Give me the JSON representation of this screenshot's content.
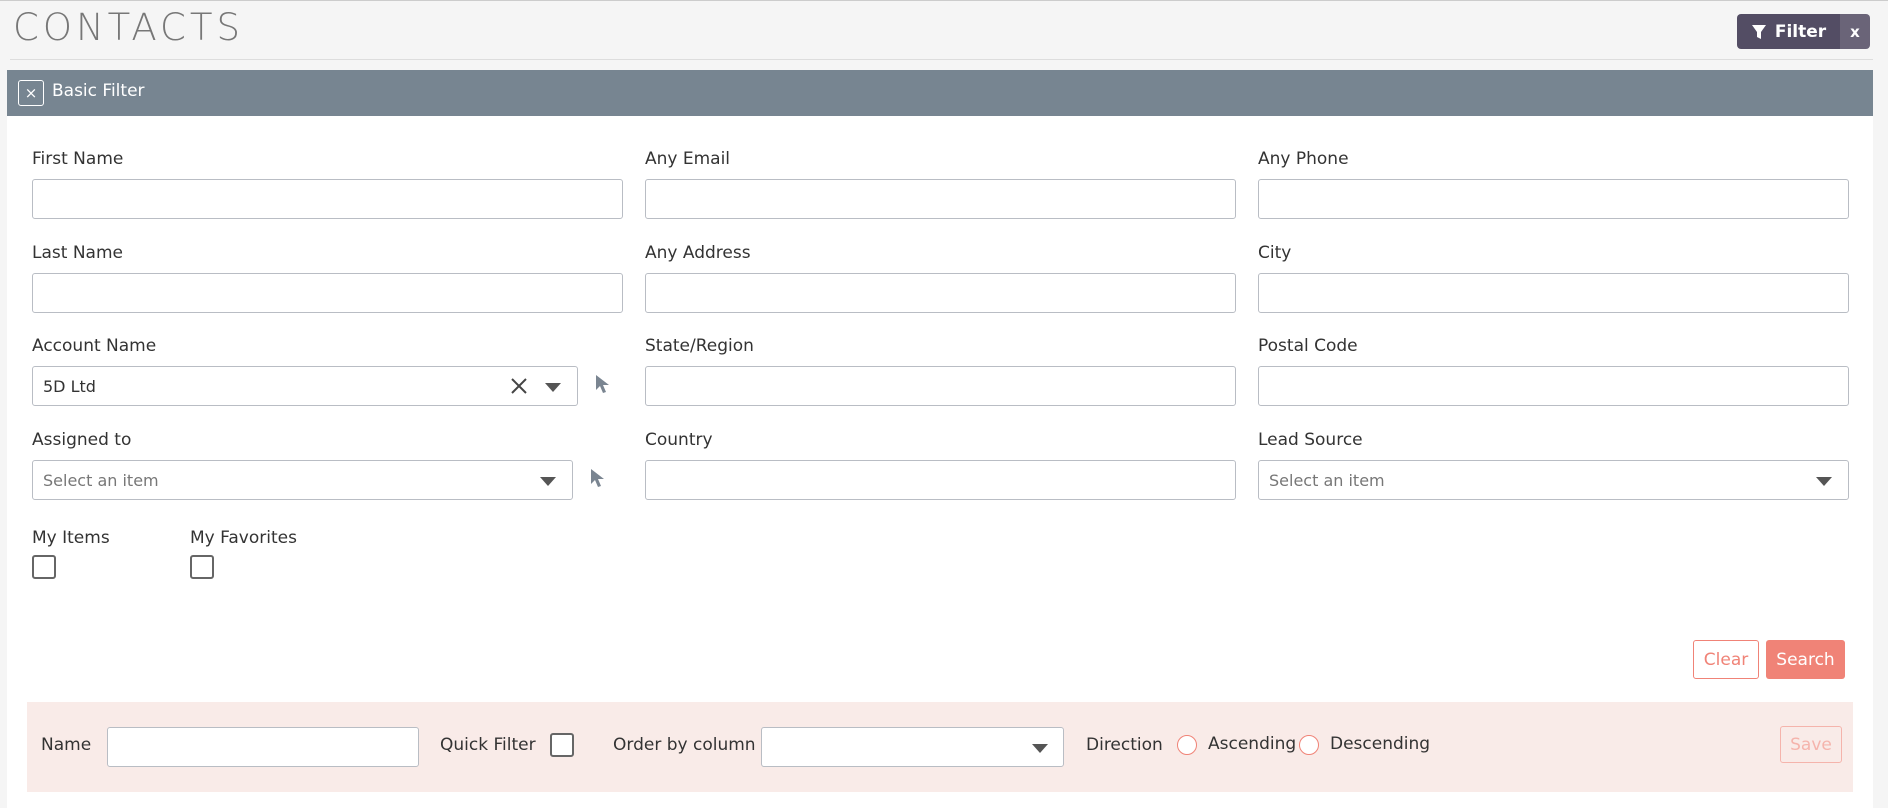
{
  "page": {
    "title": "CONTACTS"
  },
  "header": {
    "filter_label": "Filter",
    "filter_close_label": "x"
  },
  "panel": {
    "close_label": "×",
    "title": "Basic Filter"
  },
  "fields": {
    "first_name": {
      "label": "First Name",
      "value": ""
    },
    "any_email": {
      "label": "Any Email",
      "value": ""
    },
    "any_phone": {
      "label": "Any Phone",
      "value": ""
    },
    "last_name": {
      "label": "Last Name",
      "value": ""
    },
    "any_address": {
      "label": "Any Address",
      "value": ""
    },
    "city": {
      "label": "City",
      "value": ""
    },
    "account_name": {
      "label": "Account Name",
      "value": "5D Ltd"
    },
    "state_region": {
      "label": "State/Region",
      "value": ""
    },
    "postal_code": {
      "label": "Postal Code",
      "value": ""
    },
    "assigned_to": {
      "label": "Assigned to",
      "placeholder": "Select an item"
    },
    "country": {
      "label": "Country",
      "value": ""
    },
    "lead_source": {
      "label": "Lead Source",
      "placeholder": "Select an item"
    },
    "my_items": {
      "label": "My Items",
      "checked": false
    },
    "my_favorites": {
      "label": "My Favorites",
      "checked": false
    }
  },
  "actions": {
    "clear_label": "Clear",
    "search_label": "Search"
  },
  "save_bar": {
    "name_label": "Name",
    "name_value": "",
    "quick_filter_label": "Quick Filter",
    "order_by_label": "Order by column",
    "order_by_value": "",
    "direction_label": "Direction",
    "ascending_label": "Ascending",
    "descending_label": "Descending",
    "save_label": "Save"
  },
  "colors": {
    "panel_header": "#778591",
    "filter_button": "#534d64",
    "accent": "#f08377",
    "save_bar_bg": "#f9ebe8"
  },
  "icons": {
    "filter": "funnel-icon",
    "clear_selection": "close-x-icon",
    "dropdown": "chevron-down-icon",
    "select_pointer": "cursor-arrow-icon"
  }
}
